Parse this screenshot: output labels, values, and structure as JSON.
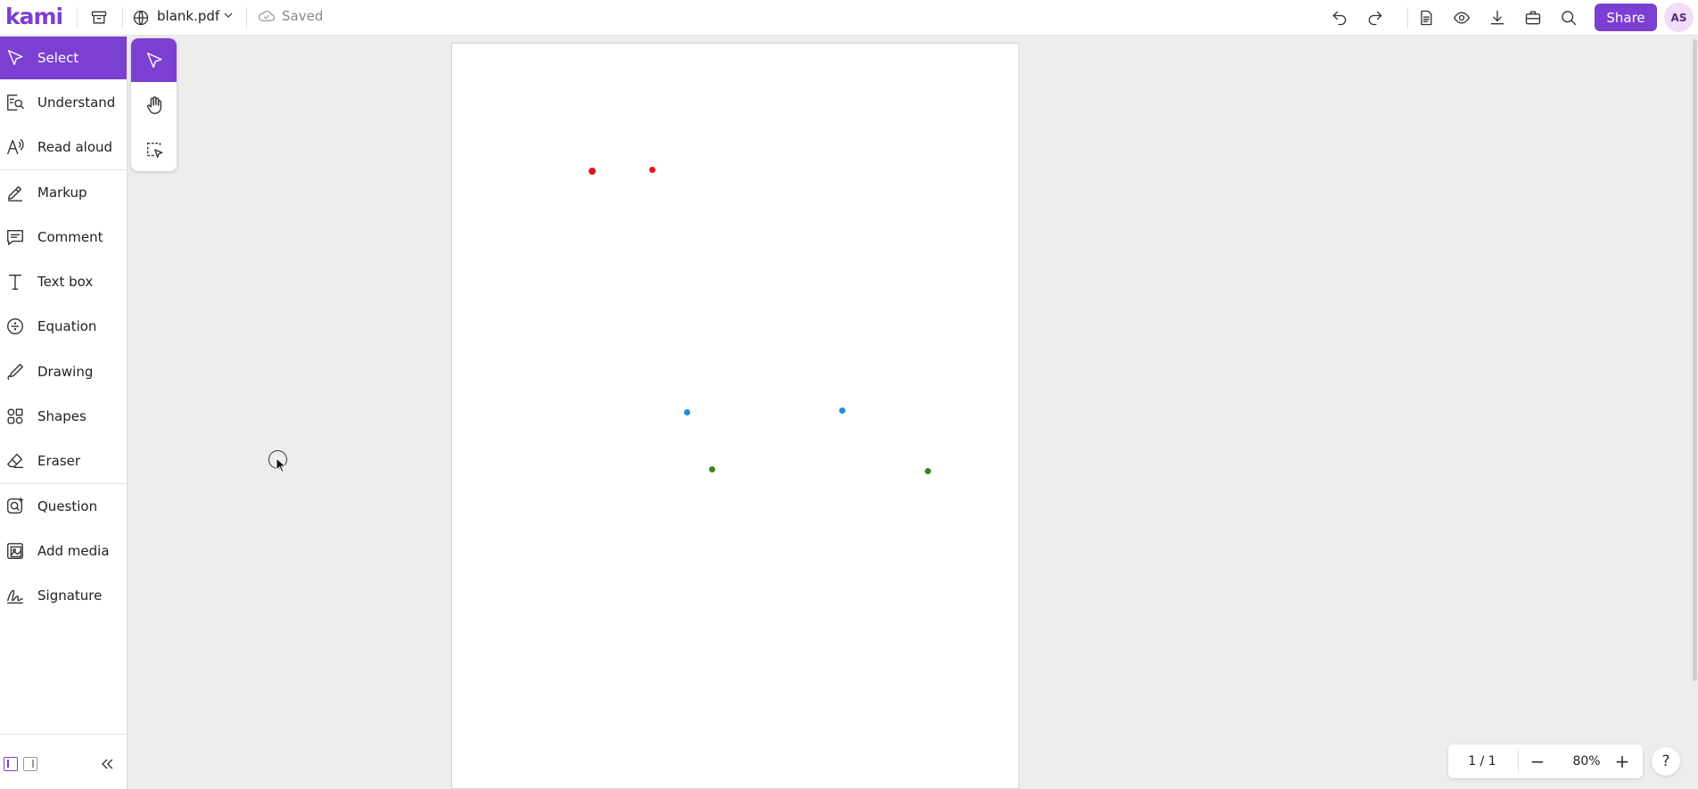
{
  "app": {
    "logo": "kami",
    "file_name": "blank.pdf",
    "save_status": "Saved"
  },
  "toolbar": {
    "icons": [
      "archive-icon",
      "globe-icon",
      "chevron-down-icon",
      "cloud-saved-icon",
      "undo-icon",
      "redo-icon",
      "document-icon",
      "eye-icon",
      "download-icon",
      "toolbox-icon",
      "search-icon"
    ],
    "share_label": "Share",
    "avatar_initials": "AS"
  },
  "sidebar": {
    "items": [
      {
        "label": "Select",
        "icon": "select-cursor-icon",
        "active": true
      },
      {
        "label": "Understand",
        "icon": "understand-icon"
      },
      {
        "label": "Read aloud",
        "icon": "read-aloud-icon"
      },
      {
        "label": "Markup",
        "icon": "markup-icon"
      },
      {
        "label": "Comment",
        "icon": "comment-icon"
      },
      {
        "label": "Text box",
        "icon": "text-box-icon"
      },
      {
        "label": "Equation",
        "icon": "equation-icon"
      },
      {
        "label": "Drawing",
        "icon": "drawing-icon"
      },
      {
        "label": "Shapes",
        "icon": "shapes-icon"
      },
      {
        "label": "Eraser",
        "icon": "eraser-icon"
      },
      {
        "label": "Question",
        "icon": "question-icon"
      },
      {
        "label": "Add media",
        "icon": "add-media-icon"
      },
      {
        "label": "Signature",
        "icon": "signature-icon"
      }
    ]
  },
  "subtools": [
    "select-pointer-icon",
    "hand-pan-icon",
    "area-select-icon"
  ],
  "canvas": {
    "dots": [
      {
        "color": "#e8141c"
      },
      {
        "color": "#e8141c"
      },
      {
        "color": "#1c8ee0"
      },
      {
        "color": "#1c8ee0"
      },
      {
        "color": "#3a8a1a"
      },
      {
        "color": "#3a8a1a"
      }
    ]
  },
  "zoom": {
    "page_indicator": "1 / 1",
    "zoom_out": "−",
    "zoom_level": "80%",
    "zoom_in": "+",
    "help": "?"
  },
  "colors": {
    "accent": "#7b3fd1",
    "background": "#ededed"
  }
}
